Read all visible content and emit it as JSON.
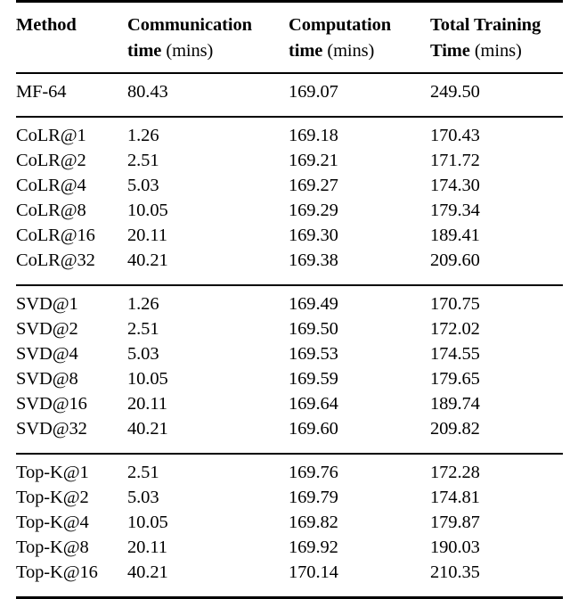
{
  "table": {
    "columns": [
      {
        "key": "method",
        "label": "Method",
        "unit": ""
      },
      {
        "key": "communication_time",
        "label": "Communication time",
        "unit": "(mins)"
      },
      {
        "key": "computation_time",
        "label": "Computation time",
        "unit": "(mins)"
      },
      {
        "key": "total_training_time",
        "label": "Total Training Time",
        "unit": "(mins)"
      }
    ],
    "header_lines": {
      "col1_line1": "Method",
      "col1_line2": "",
      "col2_line1": "Communication",
      "col2_line2_bold": "time",
      "col2_line2_unit": "(mins)",
      "col3_line1": "Computation",
      "col3_line2_bold": "time",
      "col3_line2_unit": "(mins)",
      "col4_line1": "Total Training",
      "col4_line2_bold": "Time",
      "col4_line2_unit": "(mins)"
    },
    "groups": [
      {
        "name": "baseline",
        "rows": [
          {
            "method": "MF-64",
            "communication_time": "80.43",
            "computation_time": "169.07",
            "total_training_time": "249.50"
          }
        ]
      },
      {
        "name": "colr",
        "rows": [
          {
            "method": "CoLR@1",
            "communication_time": "1.26",
            "computation_time": "169.18",
            "total_training_time": "170.43"
          },
          {
            "method": "CoLR@2",
            "communication_time": "2.51",
            "computation_time": "169.21",
            "total_training_time": "171.72"
          },
          {
            "method": "CoLR@4",
            "communication_time": "5.03",
            "computation_time": "169.27",
            "total_training_time": "174.30"
          },
          {
            "method": "CoLR@8",
            "communication_time": "10.05",
            "computation_time": "169.29",
            "total_training_time": "179.34"
          },
          {
            "method": "CoLR@16",
            "communication_time": "20.11",
            "computation_time": "169.30",
            "total_training_time": "189.41"
          },
          {
            "method": "CoLR@32",
            "communication_time": "40.21",
            "computation_time": "169.38",
            "total_training_time": "209.60"
          }
        ]
      },
      {
        "name": "svd",
        "rows": [
          {
            "method": "SVD@1",
            "communication_time": "1.26",
            "computation_time": "169.49",
            "total_training_time": "170.75"
          },
          {
            "method": "SVD@2",
            "communication_time": "2.51",
            "computation_time": "169.50",
            "total_training_time": "172.02"
          },
          {
            "method": "SVD@4",
            "communication_time": "5.03",
            "computation_time": "169.53",
            "total_training_time": "174.55"
          },
          {
            "method": "SVD@8",
            "communication_time": "10.05",
            "computation_time": "169.59",
            "total_training_time": "179.65"
          },
          {
            "method": "SVD@16",
            "communication_time": "20.11",
            "computation_time": "169.64",
            "total_training_time": "189.74"
          },
          {
            "method": "SVD@32",
            "communication_time": "40.21",
            "computation_time": "169.60",
            "total_training_time": "209.82"
          }
        ]
      },
      {
        "name": "topk",
        "rows": [
          {
            "method": "Top-K@1",
            "communication_time": "2.51",
            "computation_time": "169.76",
            "total_training_time": "172.28"
          },
          {
            "method": "Top-K@2",
            "communication_time": "5.03",
            "computation_time": "169.79",
            "total_training_time": "174.81"
          },
          {
            "method": "Top-K@4",
            "communication_time": "10.05",
            "computation_time": "169.82",
            "total_training_time": "179.87"
          },
          {
            "method": "Top-K@8",
            "communication_time": "20.11",
            "computation_time": "169.92",
            "total_training_time": "190.03"
          },
          {
            "method": "Top-K@16",
            "communication_time": "40.21",
            "computation_time": "170.14",
            "total_training_time": "210.35"
          }
        ]
      }
    ]
  }
}
